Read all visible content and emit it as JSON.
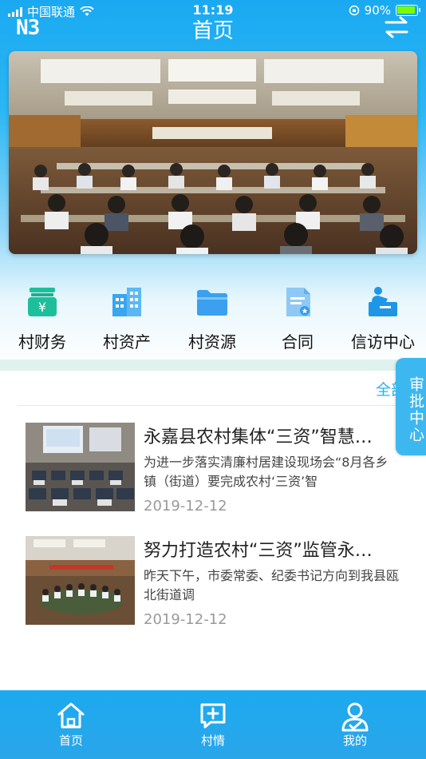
{
  "status_bar": {
    "carrier": "中国联通",
    "time": "11:19",
    "battery": "90%"
  },
  "header": {
    "logo_text": "N3",
    "title": "首页"
  },
  "categories": [
    {
      "label": "村财务",
      "icon": "money-stack-icon"
    },
    {
      "label": "村资产",
      "icon": "building-icon"
    },
    {
      "label": "村资源",
      "icon": "folder-icon"
    },
    {
      "label": "合同",
      "icon": "contract-icon"
    },
    {
      "label": "信访中心",
      "icon": "petition-icon"
    }
  ],
  "all_link": "全部",
  "side_tab": "审批中心",
  "news": [
    {
      "title": "永嘉县农村集体“三资”智慧…",
      "summary": "为进一步落实清廉村居建设现场会“8月各乡镇（街道）要完成农村‘三资’智",
      "date": "2019-12-12"
    },
    {
      "title": "努力打造农村“三资”监管永…",
      "summary": "昨天下午，市委常委、纪委书记方向到我县瓯北街道调",
      "date": "2019-12-12"
    }
  ],
  "tabs": [
    {
      "label": "首页",
      "icon": "home-icon"
    },
    {
      "label": "村情",
      "icon": "chat-plus-icon"
    },
    {
      "label": "我的",
      "icon": "user-icon"
    }
  ],
  "colors": {
    "primary": "#1da9ef",
    "accent_green": "#1dbf9b",
    "link": "#22b3ef"
  }
}
